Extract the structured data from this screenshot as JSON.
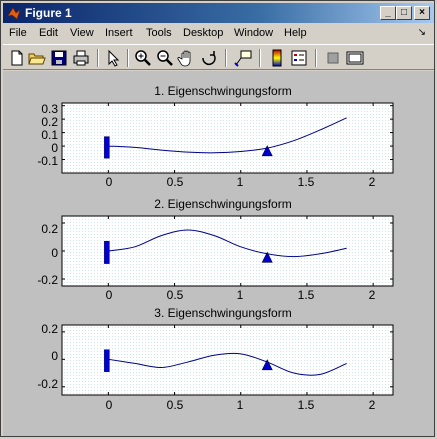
{
  "window": {
    "title": "Figure 1",
    "controls": [
      "_",
      "□",
      "×"
    ]
  },
  "menu": {
    "items": [
      {
        "label": "File"
      },
      {
        "label": "Edit"
      },
      {
        "label": "View"
      },
      {
        "label": "Insert"
      },
      {
        "label": "Tools"
      },
      {
        "label": "Desktop"
      },
      {
        "label": "Window"
      },
      {
        "label": "Help"
      }
    ],
    "dock_symbol": "↘"
  },
  "toolbar": {
    "icons": [
      "new-figure-icon",
      "open-file-icon",
      "save-icon",
      "print-icon",
      "edit-plot-arrow-icon",
      "zoom-in-icon",
      "zoom-out-icon",
      "pan-hand-icon",
      "rotate-3d-icon",
      "data-cursor-icon",
      "colorbar-icon",
      "legend-icon",
      "hide-plot-tools-icon",
      "show-plot-tools-icon"
    ]
  },
  "plots": [
    {
      "title": "1. Eigenschwingungsform",
      "ytick_labels": [
        "0.3",
        "0.2",
        "0.1",
        "0",
        "-0.1"
      ],
      "xtick_labels": [
        "0",
        "0.5",
        "1",
        "1.5",
        "2"
      ]
    },
    {
      "title": "2. Eigenschwingungsform",
      "ytick_labels": [
        "0.2",
        "0",
        "-0.2"
      ],
      "xtick_labels": [
        "0",
        "0.5",
        "1",
        "1.5",
        "2"
      ]
    },
    {
      "title": "3. Eigenschwingungsform",
      "ytick_labels": [
        "0.2",
        "0",
        "-0.2"
      ],
      "xtick_labels": [
        "0",
        "0.5",
        "1",
        "1.5",
        "2"
      ]
    }
  ],
  "chart_data": [
    {
      "type": "line",
      "title": "1. Eigenschwingungsform",
      "xlim": [
        -0.35,
        2.15
      ],
      "ylim": [
        -0.2,
        0.32
      ],
      "yticks": [
        0.3,
        0.2,
        0.1,
        0,
        -0.1
      ],
      "xticks": [
        0,
        0.5,
        1,
        1.5,
        2
      ],
      "grid": false,
      "x": [
        0,
        0.2,
        0.4,
        0.6,
        0.8,
        1.0,
        1.2,
        1.4,
        1.6,
        1.8
      ],
      "y": [
        0,
        -0.01,
        -0.03,
        -0.045,
        -0.05,
        -0.04,
        -0.015,
        0.04,
        0.12,
        0.21
      ],
      "clamp_x": 0,
      "clamp_y_range": [
        -0.09,
        0.07
      ],
      "support_x": 1.2,
      "support_y": -0.035,
      "colors": {
        "line": "#00008b",
        "support": "#0000cc"
      }
    },
    {
      "type": "line",
      "title": "2. Eigenschwingungsform",
      "xlim": [
        -0.35,
        2.15
      ],
      "ylim": [
        -0.25,
        0.25
      ],
      "yticks": [
        0.2,
        0,
        -0.2
      ],
      "xticks": [
        0,
        0.5,
        1,
        1.5,
        2
      ],
      "grid": false,
      "x": [
        0,
        0.2,
        0.4,
        0.6,
        0.8,
        1.0,
        1.2,
        1.4,
        1.6,
        1.8
      ],
      "y": [
        0,
        0.03,
        0.11,
        0.15,
        0.11,
        0.03,
        -0.02,
        -0.04,
        -0.02,
        0.02
      ],
      "clamp_x": 0,
      "clamp_y_range": [
        -0.09,
        0.07
      ],
      "support_x": 1.2,
      "support_y": -0.045,
      "colors": {
        "line": "#00008b",
        "support": "#0000cc"
      }
    },
    {
      "type": "line",
      "title": "3. Eigenschwingungsform",
      "xlim": [
        -0.35,
        2.15
      ],
      "ylim": [
        -0.26,
        0.25
      ],
      "yticks": [
        0.2,
        0,
        -0.2
      ],
      "xticks": [
        0,
        0.5,
        1,
        1.5,
        2
      ],
      "grid": false,
      "x": [
        0,
        0.2,
        0.4,
        0.6,
        0.8,
        1.0,
        1.2,
        1.4,
        1.6,
        1.8
      ],
      "y": [
        0,
        -0.03,
        -0.06,
        -0.02,
        0.03,
        0.04,
        -0.02,
        -0.1,
        -0.11,
        -0.03
      ],
      "clamp_x": 0,
      "clamp_y_range": [
        -0.09,
        0.07
      ],
      "support_x": 1.2,
      "support_y": -0.04,
      "colors": {
        "line": "#00008b",
        "support": "#0000cc"
      }
    }
  ]
}
